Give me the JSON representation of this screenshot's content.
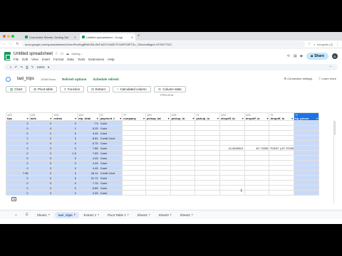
{
  "browser": {
    "tabs": [
      {
        "label": "Connected Sheets: Getting Sta",
        "active": false
      },
      {
        "label": "Untitled spreadsheet - Googl",
        "active": true
      }
    ],
    "url": "docs.google.com/spreadsheets/d/1mmPvv6cg8ReK53LtSvFaZ0Y1MZE7FUMPG5PT2v_7t0/u/edit#gid=1975077912",
    "profile": "Incognito (3)"
  },
  "doc": {
    "title": "Untitled spreadsheet",
    "status": "Saving...",
    "menus": [
      "File",
      "Edit",
      "View",
      "Insert",
      "Format",
      "Data",
      "Tools",
      "Extensions",
      "Help"
    ],
    "share_label": "Share",
    "avatar_letter": "R",
    "zoom": "100%"
  },
  "connected": {
    "sheet_name": "taxi_trips",
    "rows": "100M Rows",
    "refresh_options": "Refresh options",
    "schedule_refresh": "Schedule refresh",
    "connection_settings": "Connection settings",
    "learn_more": "Learn more",
    "buttons": [
      "Chart",
      "Pivot table",
      "Function",
      "Extract",
      "Calculated column",
      "Column stats"
    ],
    "preview_label": "PREVIEW"
  },
  "columns": [
    {
      "type": "123",
      "name": "tips"
    },
    {
      "type": "123",
      "name": "tolls"
    },
    {
      "type": "123",
      "name": "extras"
    },
    {
      "type": "123",
      "name": "trip_total"
    },
    {
      "type": "Tt",
      "name": "payment_t"
    },
    {
      "type": "Tt",
      "name": "company"
    },
    {
      "type": "123",
      "name": "pickup_lat"
    },
    {
      "type": "123",
      "name": "pickup_lo"
    },
    {
      "type": "Tt",
      "name": "pickup_lo"
    },
    {
      "type": "123",
      "name": "dropoff_la"
    },
    {
      "type": "123",
      "name": "dropoff_lo"
    },
    {
      "type": "Tt",
      "name": "dropoff_lo"
    },
    {
      "type": "Tt",
      "name": "tip_percer"
    }
  ],
  "rows": [
    [
      "3",
      "0",
      "0",
      "7.5",
      "Cash",
      "",
      "",
      "",
      "",
      "",
      "",
      "",
      ""
    ],
    [
      "0",
      "0",
      "1",
      "6.25",
      "Cash",
      "",
      "",
      "",
      "",
      "",
      "",
      "",
      ""
    ],
    [
      "0",
      "0",
      "0",
      "4.45",
      "Cash",
      "",
      "",
      "",
      "",
      "",
      "",
      "",
      ""
    ],
    [
      "2",
      "0",
      "0",
      "8.84",
      "Credit Card",
      "",
      "",
      "",
      "",
      "",
      "",
      "",
      ""
    ],
    [
      "0",
      "0",
      "0",
      "6.75",
      "Cash",
      "",
      "",
      "",
      "",
      "",
      "",
      "",
      ""
    ],
    [
      "0",
      "0",
      "0",
      "7.85",
      "Cash",
      "",
      "",
      "",
      "",
      "41.9626921",
      "-87.72255",
      "POINT (-87.7225561900 41.96261",
      ""
    ],
    [
      "0",
      "0",
      "1.5",
      "7.65",
      "Cash",
      "",
      "",
      "",
      "",
      "",
      "",
      "",
      ""
    ],
    [
      "0",
      "0",
      "0",
      "4.45",
      "Cash",
      "",
      "",
      "",
      "",
      "",
      "",
      "",
      ""
    ],
    [
      "0",
      "0",
      "0",
      "4.45",
      "Cash",
      "",
      "",
      "",
      "",
      "",
      "",
      "",
      ""
    ],
    [
      "0",
      "0",
      "0",
      "4.45",
      "Cash",
      "",
      "",
      "",
      "",
      "",
      "",
      "",
      ""
    ],
    [
      "7.65",
      "0",
      "0",
      "46.14",
      "Credit Card",
      "",
      "",
      "",
      "",
      "",
      "",
      "",
      ""
    ],
    [
      "0",
      "0",
      "6",
      "31.72",
      "Cash",
      "",
      "",
      "",
      "",
      "",
      "",
      "",
      ""
    ],
    [
      "0",
      "0",
      "0",
      "7.15",
      "Cash",
      "",
      "",
      "",
      "",
      "",
      "",
      "",
      ""
    ],
    [
      "0",
      "0",
      "0",
      "6.85",
      "Cash",
      "",
      "",
      "",
      "",
      "",
      "",
      "",
      ""
    ],
    [
      "0",
      "0",
      "0",
      "4.25",
      "Cash",
      "",
      "",
      "",
      "",
      "",
      "",
      "",
      ""
    ]
  ],
  "sheet_tabs": [
    "Sheet1",
    "taxi_trips",
    "Extract 1",
    "Pivot Table 1",
    "Sheet4",
    "Sheet3",
    "Sheet2"
  ],
  "active_sheet": "taxi_trips"
}
